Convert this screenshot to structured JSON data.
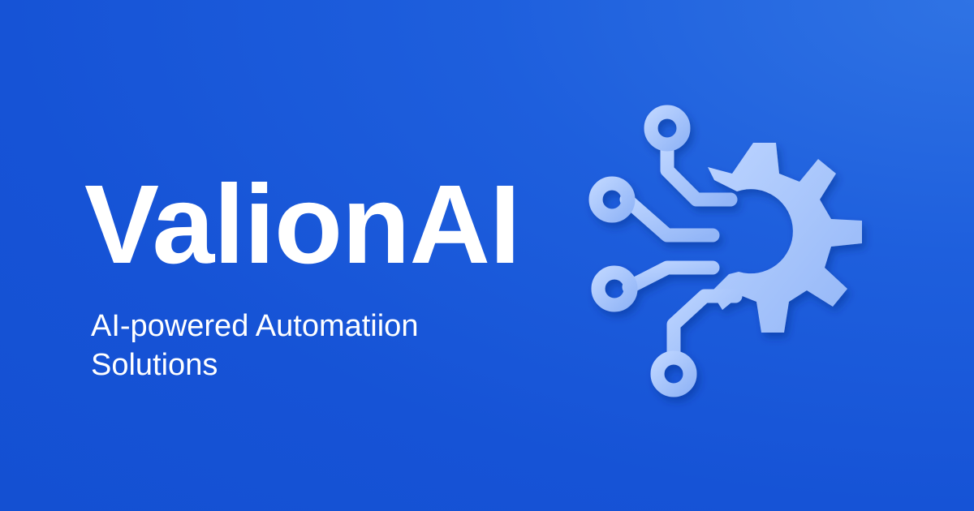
{
  "brand": {
    "name": "ValionAI",
    "tagline_line1": "AI-powered Automatiion",
    "tagline_line2": "Solutions"
  },
  "emblem": {
    "icon": "gear-circuit-icon",
    "color": "#a8c6ff"
  },
  "colors": {
    "background": "#1653d6",
    "text": "#ffffff"
  }
}
